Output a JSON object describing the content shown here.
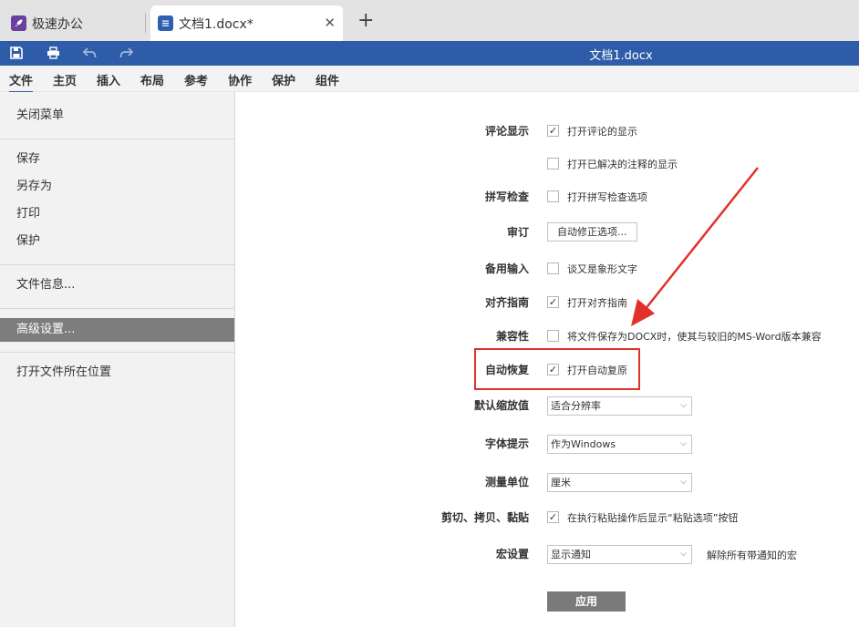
{
  "tabs": [
    {
      "label": "极速办公",
      "icon": "rocket-icon"
    },
    {
      "label": "文档1.docx*",
      "icon": "document-icon"
    }
  ],
  "titlebar": {
    "title": "文档1.docx",
    "icons": [
      "save-icon",
      "print-icon",
      "undo-icon",
      "redo-icon"
    ]
  },
  "menu": [
    "文件",
    "主页",
    "插入",
    "布局",
    "参考",
    "协作",
    "保护",
    "组件"
  ],
  "sidebar": {
    "items": [
      "关闭菜单",
      "保存",
      "另存为",
      "打印",
      "保护",
      "文件信息...",
      "高级设置...",
      "打开文件所在位置"
    ],
    "active": "高级设置..."
  },
  "settings": {
    "comments_label": "评论显示",
    "comments_opt1": "打开评论的显示",
    "comments_opt2": "打开已解决的注释的显示",
    "spell_label": "拼写检查",
    "spell_opt": "打开拼写检查选项",
    "review_label": "审订",
    "review_btn": "自动修正选项...",
    "ime_label": "备用输入",
    "ime_opt": "谈又是象形文字",
    "align_label": "对齐指南",
    "align_opt": "打开对齐指南",
    "compat_label": "兼容性",
    "compat_opt": "将文件保存为DOCX时，使其与较旧的MS-Word版本兼容",
    "autorecover_label": "自动恢复",
    "autorecover_opt": "打开自动复原",
    "zoom_label": "默认缩放值",
    "zoom_value": "适合分辨率",
    "font_label": "字体提示",
    "font_value": "作为Windows",
    "unit_label": "测量单位",
    "unit_value": "厘米",
    "paste_label": "剪切、拷贝、黏贴",
    "paste_opt": "在执行粘贴操作后显示“粘贴选项”按钮",
    "macro_label": "宏设置",
    "macro_value": "显示通知",
    "macro_note": "解除所有带通知的宏",
    "apply": "应用"
  },
  "checked": {
    "comments_opt1": true,
    "comments_opt2": false,
    "spell_opt": false,
    "ime_opt": false,
    "align_opt": true,
    "compat_opt": false,
    "autorecover_opt": true,
    "paste_opt": true
  },
  "colors": {
    "titlebar": "#2e5ca8",
    "highlight": "#e0322a",
    "active_sidebar": "#7d7d7d"
  }
}
